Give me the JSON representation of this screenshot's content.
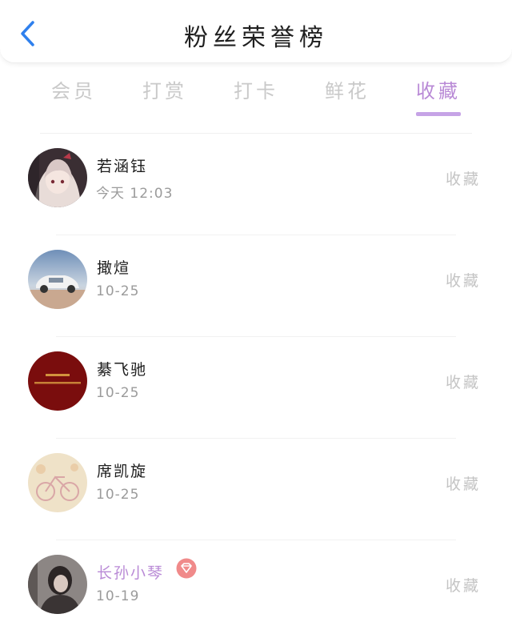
{
  "header": {
    "title": "粉丝荣誉榜",
    "back_icon": "chevron-left-icon",
    "accent_color": "#2f80ed"
  },
  "tabs": [
    {
      "label": "会员",
      "active": false
    },
    {
      "label": "打赏",
      "active": false
    },
    {
      "label": "打卡",
      "active": false
    },
    {
      "label": "鲜花",
      "active": false
    },
    {
      "label": "收藏",
      "active": true
    }
  ],
  "colors": {
    "active_tab": "#b98ad6",
    "inactive_tab": "#c9c9c9",
    "vip_name": "#b98ad6",
    "vip_badge": "#f08a8a"
  },
  "fans": [
    {
      "name": "若涵钰",
      "time": "今天 12:03",
      "action": "收藏",
      "vip": false,
      "avatar": "anime-girl-avatar"
    },
    {
      "name": "撖煊",
      "time": "10-25",
      "action": "收藏",
      "vip": false,
      "avatar": "car-avatar"
    },
    {
      "name": "綦飞驰",
      "time": "10-25",
      "action": "收藏",
      "vip": false,
      "avatar": "red-banner-avatar"
    },
    {
      "name": "席凯旋",
      "time": "10-25",
      "action": "收藏",
      "vip": false,
      "avatar": "bicycle-avatar"
    },
    {
      "name": "长孙小琴",
      "time": "10-19",
      "action": "收藏",
      "vip": true,
      "avatar": "girl-photo-avatar",
      "badge_icon": "diamond-badge-icon"
    }
  ]
}
